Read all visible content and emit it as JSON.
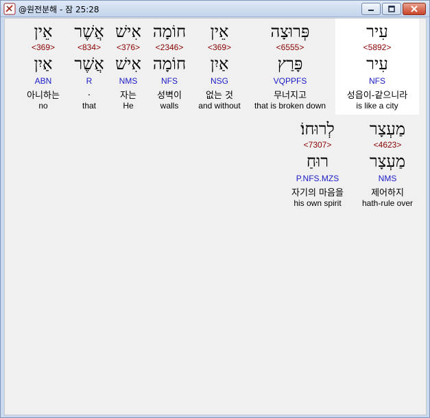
{
  "window": {
    "title": "@원전분해 - 잠 25:28",
    "minimize_label": "minimize",
    "maximize_label": "maximize",
    "close_label": "close"
  },
  "colors": {
    "strong": "#8b0000",
    "morph": "#1a1ac8",
    "selected_bg": "#ffffff"
  },
  "rows": [
    {
      "words": [
        {
          "hebrew": "עִיר",
          "strong": "<5892>",
          "lemma": "עִיר",
          "morph": "NFS",
          "korean": "성읍이-같으니라",
          "english": "is like a city",
          "selected": true
        },
        {
          "hebrew": "פְּרוּצָה",
          "strong": "<6555>",
          "lemma": "פָּרַץ",
          "morph": "VQPPFS",
          "korean": "무너지고",
          "english": "that is broken down"
        },
        {
          "hebrew": "אֵין",
          "strong": "<369>",
          "lemma": "אַיִן",
          "morph": "NSG",
          "korean": "없는 것",
          "english": "and without"
        },
        {
          "hebrew": "חוֹמָה",
          "strong": "<2346>",
          "lemma": "חוֹמָה",
          "morph": "NFS",
          "korean": "성벽이",
          "english": "walls"
        },
        {
          "hebrew": "אִישׁ",
          "strong": "<376>",
          "lemma": "אִישׁ",
          "morph": "NMS",
          "korean": "자는",
          "english": "He"
        },
        {
          "hebrew": "אֲשֶׁר",
          "strong": "<834>",
          "lemma": "אֲשֶׁר",
          "morph": "R",
          "korean": ".",
          "english": "that"
        },
        {
          "hebrew": "אֵין",
          "strong": "<369>",
          "lemma": "אַיִן",
          "morph": "ABN",
          "korean": "아니하는",
          "english": "no"
        }
      ]
    },
    {
      "words": [
        {
          "hebrew": "מַעְצָר",
          "strong": "<4623>",
          "lemma": "מַעְצָר",
          "morph": "NMS",
          "korean": "제어하지",
          "english": "hath-rule over"
        },
        {
          "hebrew": "לְרוּחוֹ׃",
          "strong": "<7307>",
          "lemma": "רוּחַ",
          "morph": "P.NFS.MZS",
          "korean": "자기의 마음을",
          "english": "his own spirit"
        }
      ]
    }
  ]
}
